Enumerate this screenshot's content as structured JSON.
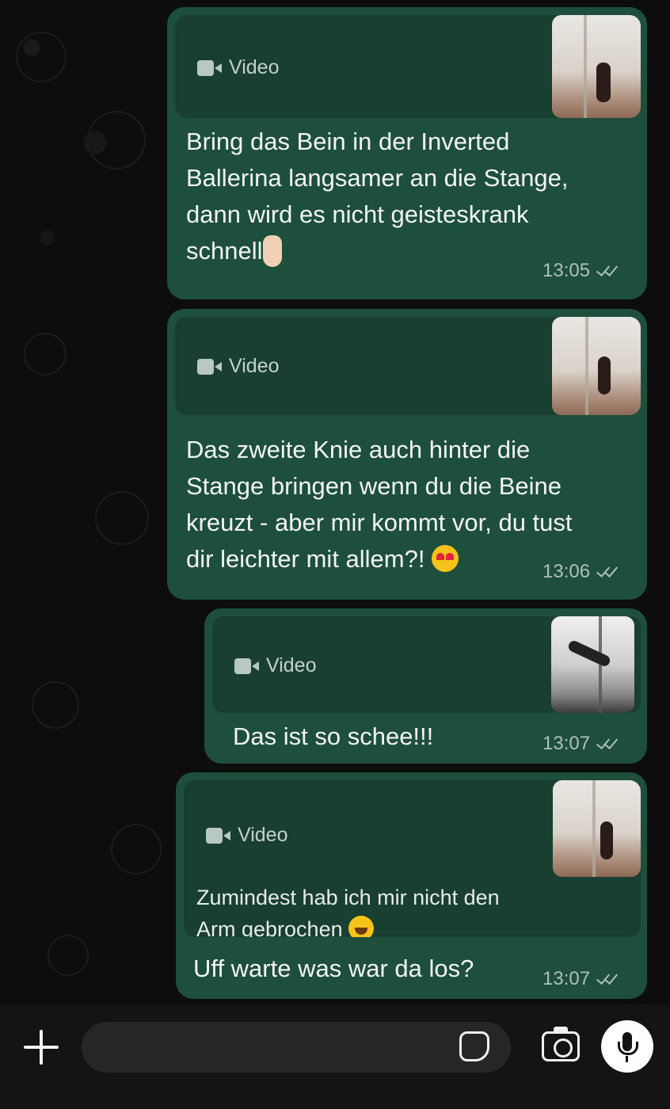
{
  "messages": [
    {
      "quote_label": "Video",
      "text_lines": [
        "Bring das Bein in der Inverted",
        "Ballerina langsamer an die Stange,",
        "dann wird es nicht geisteskrank",
        "schnell"
      ],
      "emoji": "finger",
      "time": "13:05"
    },
    {
      "quote_label": "Video",
      "text_lines": [
        "Das zweite Knie auch hinter die",
        "Stange bringen wenn du die Beine",
        "kreuzt - aber mir kommt vor, du tust",
        "dir leichter mit allem?!"
      ],
      "emoji": "heart-eyes",
      "time": "13:06"
    },
    {
      "quote_label": "Video",
      "text_lines": [
        "Das ist so schee!!!"
      ],
      "time": "13:07"
    },
    {
      "quote_label": "Video",
      "quote_text_lines": [
        "Zumindest hab ich mir nicht den",
        "Arm gebrochen"
      ],
      "quote_emoji": "tears-of-joy",
      "text_lines": [
        "Uff warte was war da los?"
      ],
      "time": "13:07"
    }
  ],
  "composer": {
    "icons": [
      "plus-icon",
      "sticker-icon",
      "camera-icon",
      "microphone-icon"
    ],
    "input_value": ""
  },
  "colors": {
    "bubble": "#1e4f3c",
    "quote": "#193f30",
    "background": "#0b0b0b"
  }
}
